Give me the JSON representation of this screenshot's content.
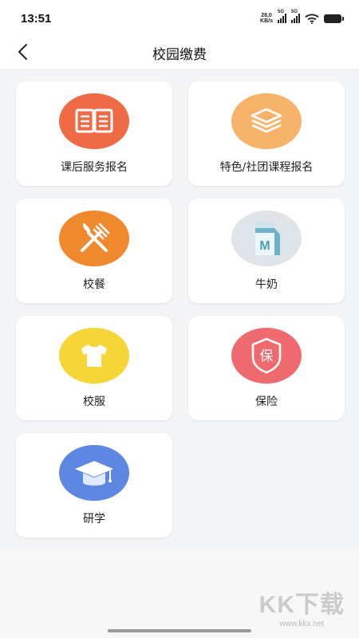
{
  "status_bar": {
    "time": "13:51",
    "net_speed_value": "28.0",
    "net_speed_unit": "KB/s",
    "sim1_label": "5G",
    "sim2_label": "5G"
  },
  "header": {
    "title": "校园缴费",
    "back_icon": "chevron-left-icon"
  },
  "colors": {
    "orange_red": "#f06a45",
    "light_orange": "#f8b36a",
    "orange": "#f0892e",
    "gray_blue": "#dfe4e8",
    "yellow": "#f6d637",
    "red": "#ef6a6e",
    "blue": "#5d87e0"
  },
  "services": [
    {
      "label": "课后服务报名",
      "icon": "book-icon"
    },
    {
      "label": "特色/社团课程报名",
      "icon": "layers-icon"
    },
    {
      "label": "校餐",
      "icon": "fork-knife-icon"
    },
    {
      "label": "牛奶",
      "icon": "milk-carton-icon"
    },
    {
      "label": "校服",
      "icon": "tshirt-icon"
    },
    {
      "label": "保险",
      "icon": "insurance-shield-icon"
    },
    {
      "label": "研学",
      "icon": "graduation-cap-icon"
    }
  ],
  "watermark": {
    "logo_text": "KK下载",
    "url": "www.kkx.net"
  }
}
